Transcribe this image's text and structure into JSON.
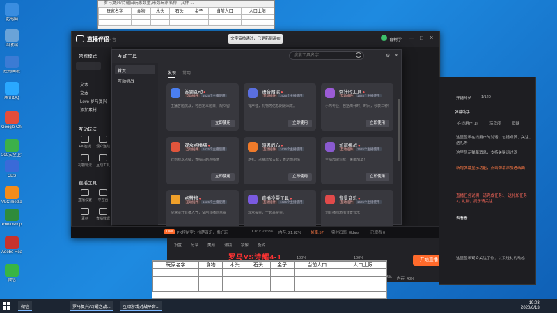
{
  "desktop_icons": [
    {
      "label": "此电脑",
      "icon": "computer-icon",
      "color": "#3a8de0"
    },
    {
      "label": "回收站",
      "icon": "recycle-bin-icon",
      "color": "#6aa3d8"
    },
    {
      "label": "控制面板",
      "icon": "control-panel-icon",
      "color": "#3b7bd4"
    },
    {
      "label": "腾讯QQ",
      "icon": "qq-icon",
      "color": "#2aa8ff"
    },
    {
      "label": "Google Chrome",
      "icon": "chrome-icon",
      "color": "#e44d3a"
    },
    {
      "label": "360安全卫士",
      "icon": "shield-icon",
      "color": "#3cb04a"
    },
    {
      "label": "CBS",
      "icon": "cbs-icon",
      "color": "#3a6ad8"
    },
    {
      "label": "VLC media player",
      "icon": "vlc-icon",
      "color": "#f28c1b"
    },
    {
      "label": "Photoshop",
      "icon": "app-icon",
      "color": "#2f8b3a"
    },
    {
      "label": "Adobe Reader",
      "icon": "pdf-icon",
      "color": "#c6322c"
    },
    {
      "label": "微信",
      "icon": "wechat-icon",
      "color": "#38b544"
    }
  ],
  "sheet_top": {
    "title": "罗马复兴/诗耀白玩家数量,来数玩家名称 - 文件 ...",
    "headers": [
      "玩家名字",
      "食物",
      "木头",
      "石头",
      "金子",
      "当前人口",
      "人口上限"
    ]
  },
  "main_window": {
    "title": "直播伴侣",
    "subtitle": "抖音",
    "toast": "文字审核通过，已更新到画布",
    "mode_label": "常规模式",
    "user": "育树学",
    "side_items": [
      "文本",
      "文本",
      "Love 罗马复兴",
      "添加素材"
    ],
    "tools_heading": "互动玩法",
    "tools": [
      "PK连线",
      "观众连线",
      "礼物玩法",
      "互动工具"
    ],
    "live_tools_heading": "直播工具",
    "live_tools": [
      "直播设置",
      "中控台",
      "素材",
      "直播数据",
      "互动工具"
    ]
  },
  "modal": {
    "title": "互动工具",
    "search_placeholder": "搜索工具名字",
    "side": [
      "首页",
      "互动挑战"
    ],
    "tabs": [
      "发现",
      "常用"
    ],
    "cards": [
      {
        "name": "答题互动",
        "tags": [
          "互动插件",
          "1625个主播使用"
        ],
        "desc": "主播答题挑战，可自定义题目，观众留",
        "button": "立即使用",
        "color": "#4a7ef0"
      },
      {
        "name": "语音朗读",
        "tags": [
          "互动插件",
          "1625个主播使用"
        ],
        "desc": "有声音，礼物等信息朗读出来。",
        "button": "立即使用",
        "color": "#5a6fe0"
      },
      {
        "name": "倒计时工具",
        "tags": [
          "互动插件",
          "1625个主播使用"
        ],
        "desc": "小巧专业，包括倒计时，时间，秒表三种模式",
        "button": "立即使用",
        "color": "#9b5bd6"
      },
      {
        "name": "观众点播墙",
        "tags": [
          "互动插件",
          "1625个主播使用"
        ],
        "desc": "收到观众点播，直播间的点播墙",
        "button": "立即使用",
        "color": "#e0553c"
      },
      {
        "name": "感恩的心",
        "tags": [
          "互动插件",
          "1625个主播使用"
        ],
        "desc": "送礼、点赞增加贡献，表达感谢情",
        "button": "立即使用",
        "color": "#f07b2a"
      },
      {
        "name": "加减挑战",
        "tags": [
          "互动插件",
          "1625个主播使用"
        ],
        "desc": "主播加减对抗，来做加法！",
        "button": "立即使用",
        "color": "#8a5ad0"
      },
      {
        "name": "点赞榜",
        "tags": [
          "互动插件",
          "1625个主播使用"
        ],
        "desc": "快速提升直播人气，试用直播间点赞",
        "button": "立即使用",
        "color": "#f0a02a"
      },
      {
        "name": "直播投票工具",
        "tags": [
          "互动插件",
          "1625个主播使用"
        ],
        "desc": "观众投票，一起来投票。",
        "button": "立即使用",
        "color": "#7a5ae0"
      },
      {
        "name": "背景音乐",
        "tags": [
          "互动插件",
          "1625个主播使用"
        ],
        "desc": "为直播间添加背景音乐",
        "button": "立即使用",
        "color": "#e04a4a"
      }
    ]
  },
  "status_bar": {
    "live": "Live",
    "items": [
      "PK控制室：拉萨音乐，抱好玩",
      "CPU: 2.69%",
      "内存: 21.82%",
      "帧率:57",
      "实时码率: 0kbps",
      "已观看 0"
    ]
  },
  "control": {
    "items": [
      "设置",
      "分享",
      "美颜",
      "滤镜",
      "镜像",
      "旋转"
    ],
    "vol1": "100%",
    "vol2": "100%",
    "overlay": "罗马VS诗耀4-1",
    "start": "开始直播",
    "stats": [
      "CPU: 3%",
      "内存: 40%",
      "帧率: 60",
      "延迟"
    ]
  },
  "right_panel": {
    "title": "开播时长",
    "count": "1/120",
    "assistant": "弹幕助手",
    "tabs": [
      "在线用户(1)",
      "活跃度",
      "贡献"
    ],
    "lines": [
      "这里显示在线用户的对话，包括点赞、关注、送礼等",
      "这里显示弹幕消息，支持关键词过滤",
      "新增弹幕显示功能，点击弹幕添加进画面",
      "直播任务说明：请完成任务1，送礼加任务3，礼物，提示请关注",
      "去看看",
      "这里显示观众关注了你，以及送礼的动态"
    ]
  },
  "sheet_bottom": {
    "headers": [
      "玩家名字",
      "食物",
      "木头",
      "石头",
      "金子",
      "当前人口",
      "人口上限"
    ]
  },
  "taskbar": {
    "items": [
      "微信",
      "罗马复兴/诗耀之战...",
      "互动游戏对战平台..."
    ],
    "time": "19:03",
    "date": "2020/6/13"
  }
}
